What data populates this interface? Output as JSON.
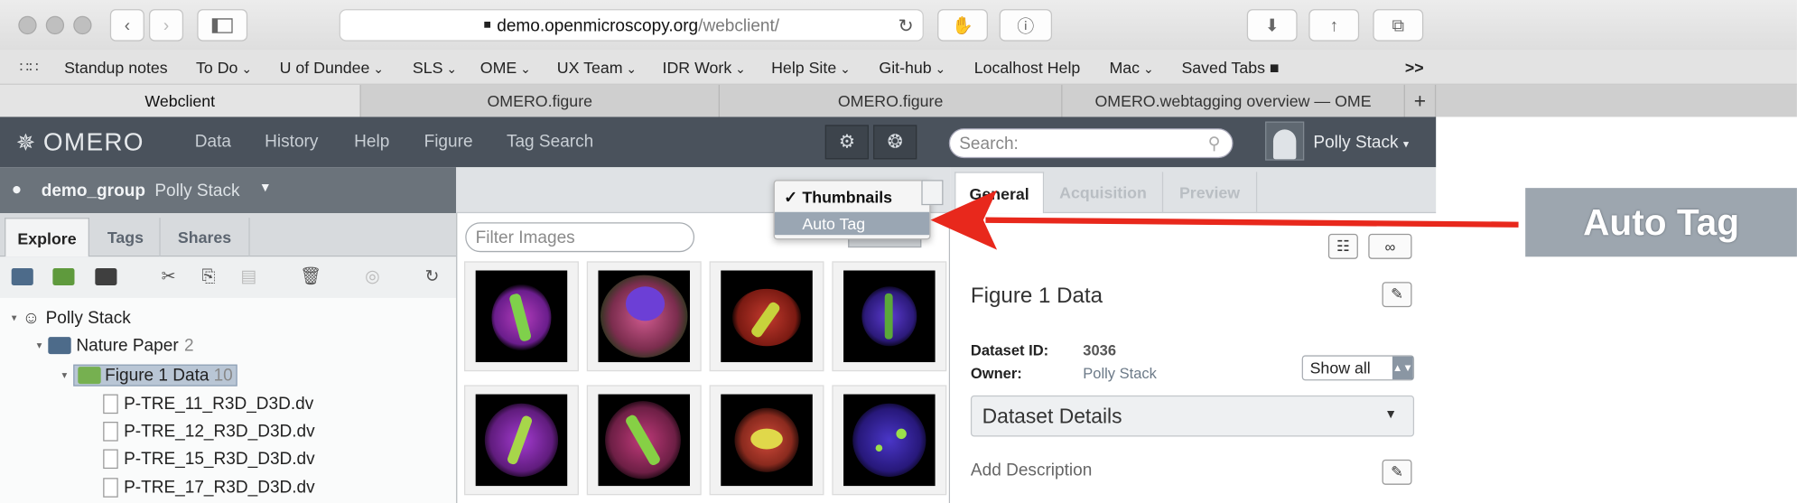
{
  "browser": {
    "url_host": "demo.openmicroscopy.org",
    "url_path": "/webclient/",
    "bookmarks": [
      {
        "label": "Standup notes"
      },
      {
        "label": "To Do",
        "menu": true
      },
      {
        "label": "U of Dundee",
        "menu": true
      },
      {
        "label": "SLS",
        "menu": true
      },
      {
        "label": "OME",
        "menu": true
      },
      {
        "label": "UX Team",
        "menu": true
      },
      {
        "label": "IDR Work",
        "menu": true
      },
      {
        "label": "Help Site",
        "menu": true
      },
      {
        "label": "Git-hub",
        "menu": true
      },
      {
        "label": "Localhost Help"
      },
      {
        "label": "Mac",
        "menu": true
      },
      {
        "label": "Saved Tabs ■"
      }
    ],
    "overflow": ">>",
    "tabs": [
      {
        "label": "Webclient",
        "active": true
      },
      {
        "label": "OMERO.figure"
      },
      {
        "label": "OMERO.figure"
      },
      {
        "label": "OMERO.webtagging overview — OME"
      }
    ],
    "new_tab": "+"
  },
  "app": {
    "logo": "OMERO",
    "nav": [
      "Data",
      "History",
      "Help",
      "Figure",
      "Tag Search"
    ],
    "search_placeholder": "Search:",
    "user": "Polly Stack",
    "group": "demo_group",
    "group_user": "Polly Stack"
  },
  "left": {
    "tabs": [
      "Explore",
      "Tags",
      "Shares"
    ],
    "tools": [
      "folder-icon",
      "dataset-icon",
      "screen-icon",
      "cut-icon",
      "copy-icon",
      "paste-icon",
      "delete-icon",
      "share-icon",
      "refresh-icon"
    ],
    "tree": {
      "root": "Polly Stack",
      "project": "Nature Paper",
      "project_count": "2",
      "dataset": "Figure 1 Data",
      "dataset_count": "10",
      "images": [
        "P-TRE_11_R3D_D3D.dv",
        "P-TRE_12_R3D_D3D.dv",
        "P-TRE_15_R3D_D3D.dv",
        "P-TRE_17_R3D_D3D.dv"
      ]
    }
  },
  "center": {
    "filter_placeholder": "Filter Images",
    "dropdown": {
      "checked": "Thumbnails",
      "highlighted": "Auto Tag",
      "check_mark": "✓"
    }
  },
  "right": {
    "tabs": [
      "General",
      "Acquisition",
      "Preview"
    ],
    "title": "Figure 1 Data",
    "dataset_id_label": "Dataset ID:",
    "dataset_id": "3036",
    "owner_label": "Owner:",
    "owner": "Polly Stack",
    "show_all": "Show all",
    "details_panel": "Dataset Details",
    "add_description": "Add Description"
  },
  "callout": {
    "label": "Auto Tag"
  },
  "colors": {
    "arrow": "#e8281c",
    "nav_bg": "#4a525c",
    "highlight": "#9aa6b3"
  }
}
